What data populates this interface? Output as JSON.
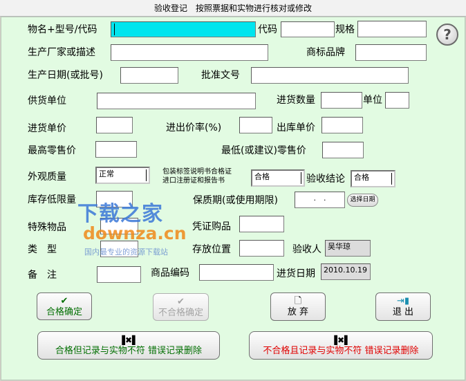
{
  "window": {
    "title": "验收登记　按照票据和实物进行核对或修改"
  },
  "labels": {
    "name_model_code": "物名+型号/代码",
    "code": "代码",
    "spec": "规格",
    "manufacturer": "生产厂家或描述",
    "brand": "商标品牌",
    "production_date": "生产日期(或批号)",
    "approval_no": "批准文号",
    "supplier": "供货单位",
    "purchase_qty": "进货数量",
    "unit": "单位",
    "purchase_price": "进货单价",
    "markup_rate": "进出价率(%)",
    "out_price": "出库单价",
    "max_retail": "最高零售价",
    "min_retail": "最低(或建议)零售价",
    "appearance": "外观质量",
    "package_line1": "包装标签说明书合格证",
    "package_line2": "进口注册证和报告书",
    "conclusion": "验收结论",
    "stock_low": "库存低限量",
    "shelf_life": "保质期(或使用期限)",
    "special": "特殊物品",
    "voucher": "凭证购品",
    "type": "类　型",
    "location": "存放位置",
    "inspector": "验收人",
    "remark": "备　注",
    "goods_code": "商品编码",
    "purchase_date": "进货日期"
  },
  "values": {
    "name_model_code": "",
    "code": "",
    "spec": "",
    "manufacturer": "",
    "brand": "",
    "production_date": "",
    "approval_no": "",
    "supplier": "",
    "purchase_qty": "",
    "unit": "",
    "purchase_price": "",
    "markup_rate": "",
    "out_price": "",
    "max_retail": "",
    "min_retail": "",
    "appearance": "正常",
    "package": "合格",
    "conclusion": "合格",
    "stock_low": "",
    "shelf_life": ".　.",
    "special": "",
    "voucher": "",
    "type": "",
    "location": "",
    "inspector": "吴华琼",
    "remark": "",
    "goods_code": "",
    "purchase_date": "2010.10.19"
  },
  "buttons": {
    "select_date": "选择日期",
    "help": "?",
    "pass": "合格确定",
    "fail": "不合格确定",
    "discard": "放 弃",
    "exit": "退 出",
    "pass_mismatch": "合格但记录与实物不符  错误记录删除",
    "fail_mismatch": "不合格且记录与实物不符  错误记录删除"
  },
  "icons": {
    "pass": "check-icon",
    "fail": "check-icon",
    "discard": "document-icon",
    "exit": "exit-door-icon",
    "mismatch": "delete-record-icon"
  },
  "watermark": {
    "line1": "下载之家",
    "line2": "downza.cn",
    "line3": "国内最专业的资源下载站"
  },
  "colors": {
    "background": "#e2fbe2",
    "active_field": "#00e5ee",
    "pass_text": "#006e00",
    "fail_text": "#e00000"
  }
}
